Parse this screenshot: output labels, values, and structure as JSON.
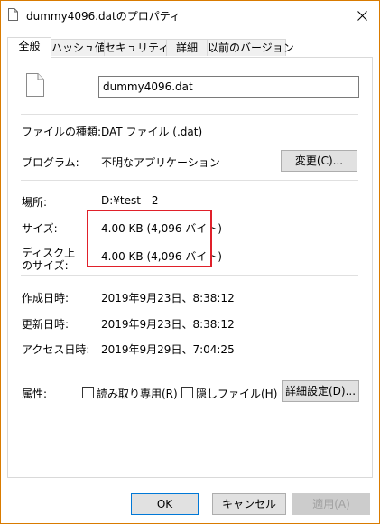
{
  "window": {
    "title": "dummy4096.datのプロパティ"
  },
  "tabs": [
    {
      "label": "全般"
    },
    {
      "label": "ハッシュ値"
    },
    {
      "label": "セキュリティ"
    },
    {
      "label": "詳細"
    },
    {
      "label": "以前のバージョン"
    }
  ],
  "general": {
    "file_name": "dummy4096.dat",
    "file_type_label": "ファイルの種類:",
    "file_type_value": "DAT ファイル (.dat)",
    "program_label": "プログラム:",
    "program_value": "不明なアプリケーション",
    "change_button": "変更(C)...",
    "location_label": "場所:",
    "location_value": "D:¥test - 2",
    "size_label": "サイズ:",
    "size_value": "4.00 KB (4,096 バイト)",
    "size_on_disk_label_line1": "ディスク上",
    "size_on_disk_label_line2": "のサイズ:",
    "size_on_disk_value": "4.00 KB (4,096 バイト)",
    "created_label": "作成日時:",
    "created_value": "2019年9月23日、8:38:12",
    "modified_label": "更新日時:",
    "modified_value": "2019年9月23日、8:38:12",
    "accessed_label": "アクセス日時:",
    "accessed_value": "2019年9月29日、7:04:25",
    "attributes_label": "属性:",
    "readonly_label": "読み取り専用(R)",
    "hidden_label": "隠しファイル(H)",
    "advanced_button": "詳細設定(D)..."
  },
  "footer": {
    "ok": "OK",
    "cancel": "キャンセル",
    "apply": "適用(A)"
  },
  "colors": {
    "accent": "#0078d7",
    "window_border": "#d97b00",
    "highlight_box": "#e0202a"
  }
}
